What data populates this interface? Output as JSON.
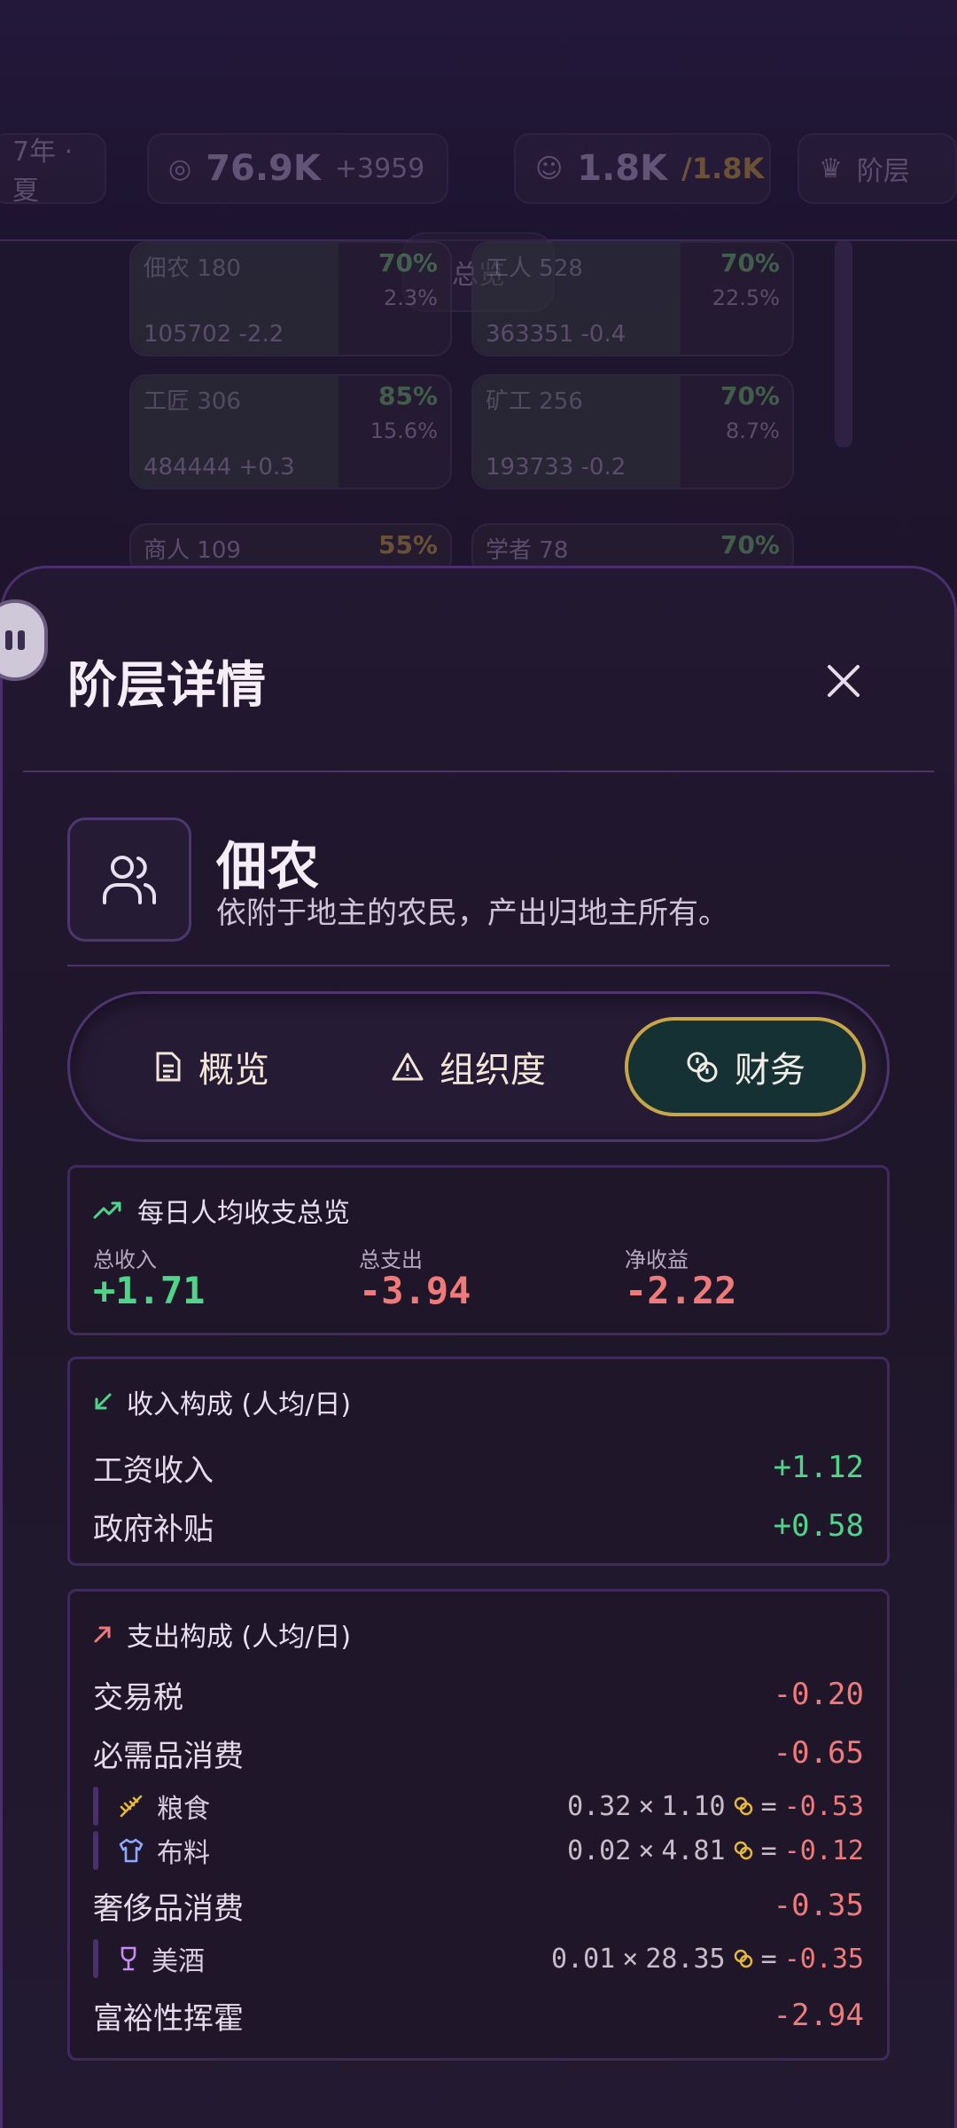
{
  "background": {
    "season": "7年 · 夏",
    "money": "76.9K",
    "money_delta": "+3959",
    "population": "1.8K",
    "population_max": "/1.8K",
    "classes_button": "阶层",
    "overview_button": "总览",
    "cards": [
      {
        "name": "佃农",
        "count": "180",
        "pct": "70%",
        "sub": "2.3%",
        "wealth": "105702",
        "delta": "-2.2"
      },
      {
        "name": "工人",
        "count": "528",
        "pct": "70%",
        "sub": "22.5%",
        "wealth": "363351",
        "delta": "-0.4"
      },
      {
        "name": "工匠",
        "count": "306",
        "pct": "85%",
        "sub": "15.6%",
        "wealth": "484444",
        "delta": "+0.3"
      },
      {
        "name": "矿工",
        "count": "256",
        "pct": "70%",
        "sub": "8.7%",
        "wealth": "193733",
        "delta": "-0.2"
      },
      {
        "name": "商人",
        "count": "109",
        "pct": "55%"
      },
      {
        "name": "学者",
        "count": "78",
        "pct": "70%"
      }
    ]
  },
  "sheet": {
    "title": "阶层详情",
    "class_name": "佃农",
    "class_desc": "依附于地主的农民，产出归地主所有。"
  },
  "tabs": [
    {
      "label": "概览",
      "icon": "document-icon"
    },
    {
      "label": "组织度",
      "icon": "warning-icon"
    },
    {
      "label": "财务",
      "icon": "coins-icon",
      "active": true
    }
  ],
  "summary": {
    "title": "每日人均收支总览",
    "income_label": "总收入",
    "income": "+1.71",
    "expense_label": "总支出",
    "expense": "-3.94",
    "net_label": "净收益",
    "net": "-2.22"
  },
  "income": {
    "title": "收入构成 (人均/日)",
    "rows": [
      {
        "label": "工资收入",
        "value": "+1.12"
      },
      {
        "label": "政府补贴",
        "value": "+0.58"
      }
    ]
  },
  "expense": {
    "title": "支出构成 (人均/日)",
    "trade_tax": {
      "label": "交易税",
      "value": "-0.20"
    },
    "necessities": {
      "label": "必需品消费",
      "value": "-0.65",
      "items": [
        {
          "name": "粮食",
          "qty": "0.32",
          "price": "1.10",
          "total": "-0.53"
        },
        {
          "name": "布料",
          "qty": "0.02",
          "price": "4.81",
          "total": "-0.12"
        }
      ]
    },
    "luxury": {
      "label": "奢侈品消费",
      "value": "-0.35",
      "items": [
        {
          "name": "美酒",
          "qty": "0.01",
          "price": "28.35",
          "total": "-0.35"
        }
      ]
    },
    "lavish": {
      "label": "富裕性挥霍",
      "value": "-2.94"
    }
  },
  "colors": {
    "accent_gold": "#c7a548",
    "positive": "#4fd58a",
    "negative": "#f07a7a",
    "border": "#4a2f6e"
  }
}
